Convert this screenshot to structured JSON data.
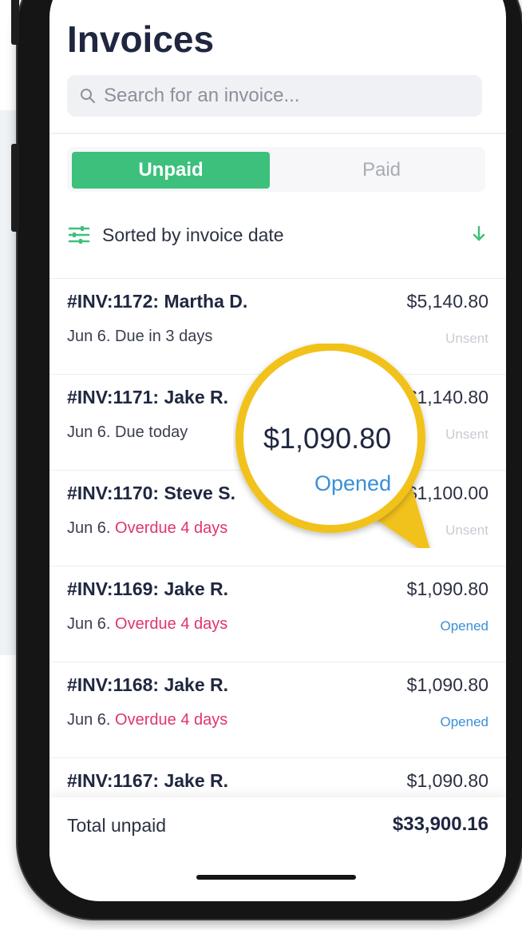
{
  "app": {
    "title": "Invoices"
  },
  "search": {
    "placeholder": "Search for an invoice..."
  },
  "tabs": [
    {
      "label": "Unpaid",
      "active": true
    },
    {
      "label": "Paid",
      "active": false
    }
  ],
  "sort": {
    "label": "Sorted by invoice date"
  },
  "invoices": [
    {
      "name": "#INV:1172: Martha  D.",
      "amount": "$5,140.80",
      "date": "Jun 6.",
      "due": "Due in 3 days",
      "status": "Unsent",
      "overdue": false
    },
    {
      "name": "#INV:1171: Jake R.",
      "amount": "$1,140.80",
      "date": "Jun 6.",
      "due": "Due today",
      "status": "Unsent",
      "overdue": false
    },
    {
      "name": "#INV:1170: Steve S.",
      "amount": "$1,100.00",
      "date": "Jun 6.",
      "due": "Overdue 4 days",
      "status": "Unsent",
      "overdue": true
    },
    {
      "name": "#INV:1169: Jake R.",
      "amount": "$1,090.80",
      "date": "Jun 6.",
      "due": "Overdue 4 days",
      "status": "Opened",
      "overdue": true
    },
    {
      "name": "#INV:1168: Jake R.",
      "amount": "$1,090.80",
      "date": "Jun 6.",
      "due": "Overdue 4 days",
      "status": "Opened",
      "overdue": true
    },
    {
      "name": "#INV:1167: Jake R.",
      "amount": "$1,090.80",
      "date": "",
      "due": "",
      "status": "",
      "overdue": false
    }
  ],
  "total": {
    "label": "Total unpaid",
    "value": "$33,900.16"
  },
  "callout": {
    "amount": "$1,090.80",
    "status": "Opened"
  },
  "colors": {
    "accent_green": "#3dc07c",
    "overdue_red": "#e0356a",
    "opened_blue": "#3a8fd8",
    "callout_yellow": "#f2c21b"
  },
  "icons": {
    "search": "search-icon",
    "filter": "filter-sliders-icon",
    "sort_direction": "arrow-down-icon"
  }
}
